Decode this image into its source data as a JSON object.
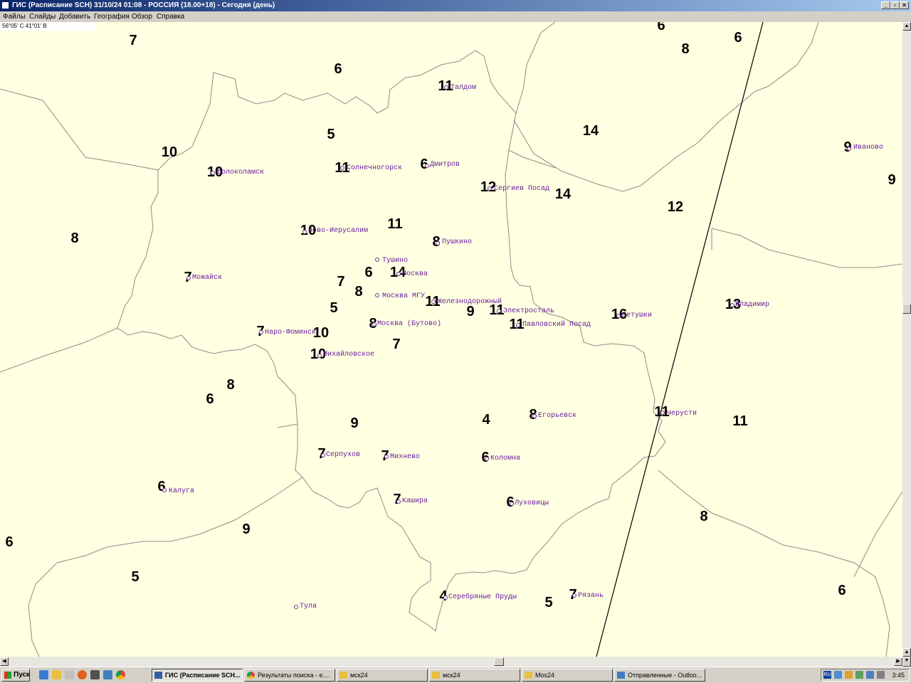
{
  "window": {
    "title": "ГИС (Расписание SCH) 31/10/24 01:08 - РОССИЯ (18.00+18) - Сегодня (день)",
    "buttons": [
      "_",
      "▫",
      "×"
    ]
  },
  "menu": [
    "Файлы",
    "Слайды",
    "Добавить",
    "География",
    "Обзор",
    "Справка"
  ],
  "coordinates": "56°05' С 41°01' В",
  "map": {
    "numbers": [
      "6",
      "7",
      "6",
      "8",
      "6",
      "11",
      "5",
      "14",
      "10",
      "10",
      "11",
      "6",
      "12",
      "14",
      "9",
      "9",
      "12",
      "8",
      "10",
      "11",
      "8",
      "7",
      "6",
      "14",
      "7",
      "8",
      "11",
      "9",
      "11",
      "13",
      "5",
      "16",
      "8",
      "11",
      "7",
      "10",
      "7",
      "10",
      "8",
      "6",
      "11",
      "11",
      "9",
      "4",
      "8",
      "7",
      "7",
      "6",
      "6",
      "7",
      "6",
      "6",
      "9",
      "8",
      "5",
      "6",
      "4",
      "7",
      "5"
    ],
    "cities": [
      "Талдом",
      "Волоколамск",
      "Солнечногорск",
      "Дмитров",
      "Сергиев Посад",
      "Иваново",
      "Ново-Иерусалим",
      "Пушкино",
      "Тушино",
      "Москва",
      "Можайск",
      "Москва МГУ",
      "Железнодорожный",
      "Электросталь",
      "Петушки",
      "Владимир",
      "Наро-Фоминск",
      "Москва (Бутово)",
      "Павловский Посад",
      "Михайловское",
      "Егорьевск",
      "Черусти",
      "Серпухов",
      "Михнево",
      "Коломна",
      "Калуга",
      "Кашира",
      "Луховицы",
      "Тула",
      "Серебряные Пруды",
      "Рязань"
    ]
  },
  "taskbar": {
    "start": "Пуск",
    "tasks": [
      "ГИС (Расписание SCH...",
      "Результаты поиска - e....",
      "мск24",
      "мск24",
      "Mos24",
      "Отправленные - Outloo..."
    ],
    "lang": "RU",
    "clock": "3:45"
  },
  "colors": {
    "map_background": "#ffffe1",
    "city_label": "#6a1fa0",
    "title_gradient_start": "#0a246a",
    "title_gradient_end": "#a6caf0"
  }
}
